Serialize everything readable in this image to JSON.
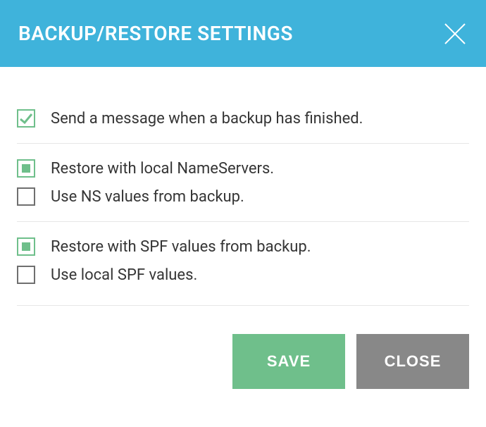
{
  "header": {
    "title": "BACKUP/RESTORE SETTINGS"
  },
  "groups": [
    {
      "options": [
        {
          "label": "Send a message when a backup has finished.",
          "state": "checked-tick"
        }
      ]
    },
    {
      "options": [
        {
          "label": "Restore with local NameServers.",
          "state": "checked-square"
        },
        {
          "label": "Use NS values from backup.",
          "state": "unchecked"
        }
      ]
    },
    {
      "options": [
        {
          "label": "Restore with SPF values from backup.",
          "state": "checked-square"
        },
        {
          "label": "Use local SPF values.",
          "state": "unchecked"
        }
      ]
    }
  ],
  "footer": {
    "save_label": "SAVE",
    "close_label": "CLOSE"
  }
}
